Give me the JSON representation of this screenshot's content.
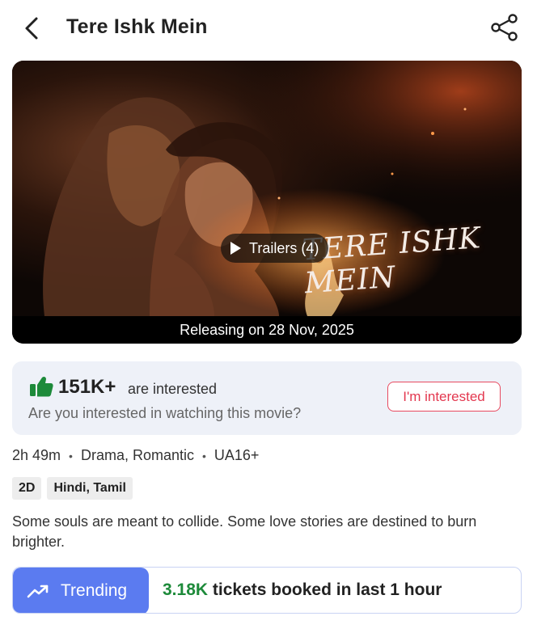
{
  "header": {
    "title": "Tere Ishk Mein"
  },
  "banner": {
    "trailers_label": "Trailers (4)",
    "wordmark": "TERE ISHK MEIN",
    "release_text": "Releasing on 28 Nov, 2025"
  },
  "interest": {
    "count": "151K+",
    "label": "are interested",
    "question": "Are you interested in watching this movie?",
    "button_label": "I'm interested",
    "accent": "#e3384f",
    "thumb_color": "#1d8a3a"
  },
  "meta": {
    "duration": "2h 49m",
    "genres": "Drama, Romantic",
    "rating": "UA16+"
  },
  "tags": {
    "format": "2D",
    "languages": "Hindi, Tamil"
  },
  "synopsis": "Some souls are meant to collide. Some love stories are destined to burn brighter.",
  "trending": {
    "label": "Trending",
    "count": "3.18K",
    "text": "tickets booked in last 1 hour",
    "pill_color": "#5b7bf0"
  }
}
